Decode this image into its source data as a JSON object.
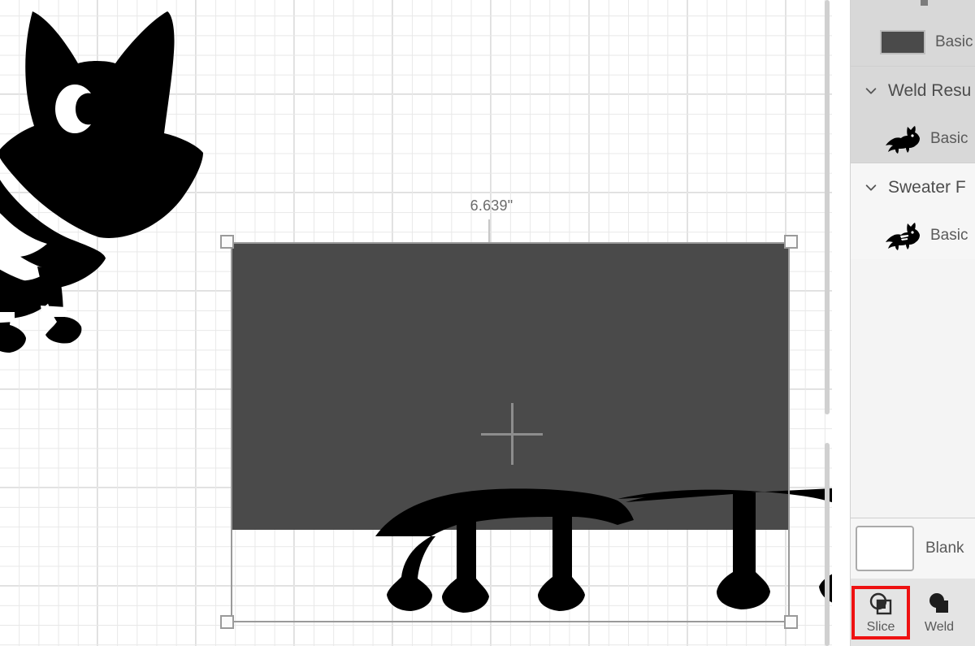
{
  "canvas": {
    "dimension_label": "6.639\"",
    "shape_color": "#4a4a4a",
    "grid_color": "#e8e8e8",
    "selection_border_color": "#9a9a9a",
    "center_marker": "crosshair-icon",
    "artwork_name": "fox-silhouette"
  },
  "panel": {
    "layers": [
      {
        "kind": "item",
        "icon": "rectangle-swatch-icon",
        "label": "Basic",
        "selected": true
      },
      {
        "kind": "group",
        "icon": "chevron-down-icon",
        "label": "Weld Resu",
        "selected": true
      },
      {
        "kind": "item",
        "icon": "fox-silhouette-icon",
        "label": "Basic",
        "selected": true
      },
      {
        "kind": "group",
        "icon": "chevron-down-icon",
        "label": "Sweater F",
        "selected": false
      },
      {
        "kind": "item",
        "icon": "fox-sweater-icon",
        "label": "Basic",
        "selected": false
      }
    ],
    "blank_row": {
      "icon": "blank-canvas-swatch-icon",
      "label": "Blank"
    },
    "tools": [
      {
        "icon": "slice-icon",
        "label": "Slice",
        "highlighted": true
      },
      {
        "icon": "weld-icon",
        "label": "Weld",
        "highlighted": false
      }
    ]
  }
}
